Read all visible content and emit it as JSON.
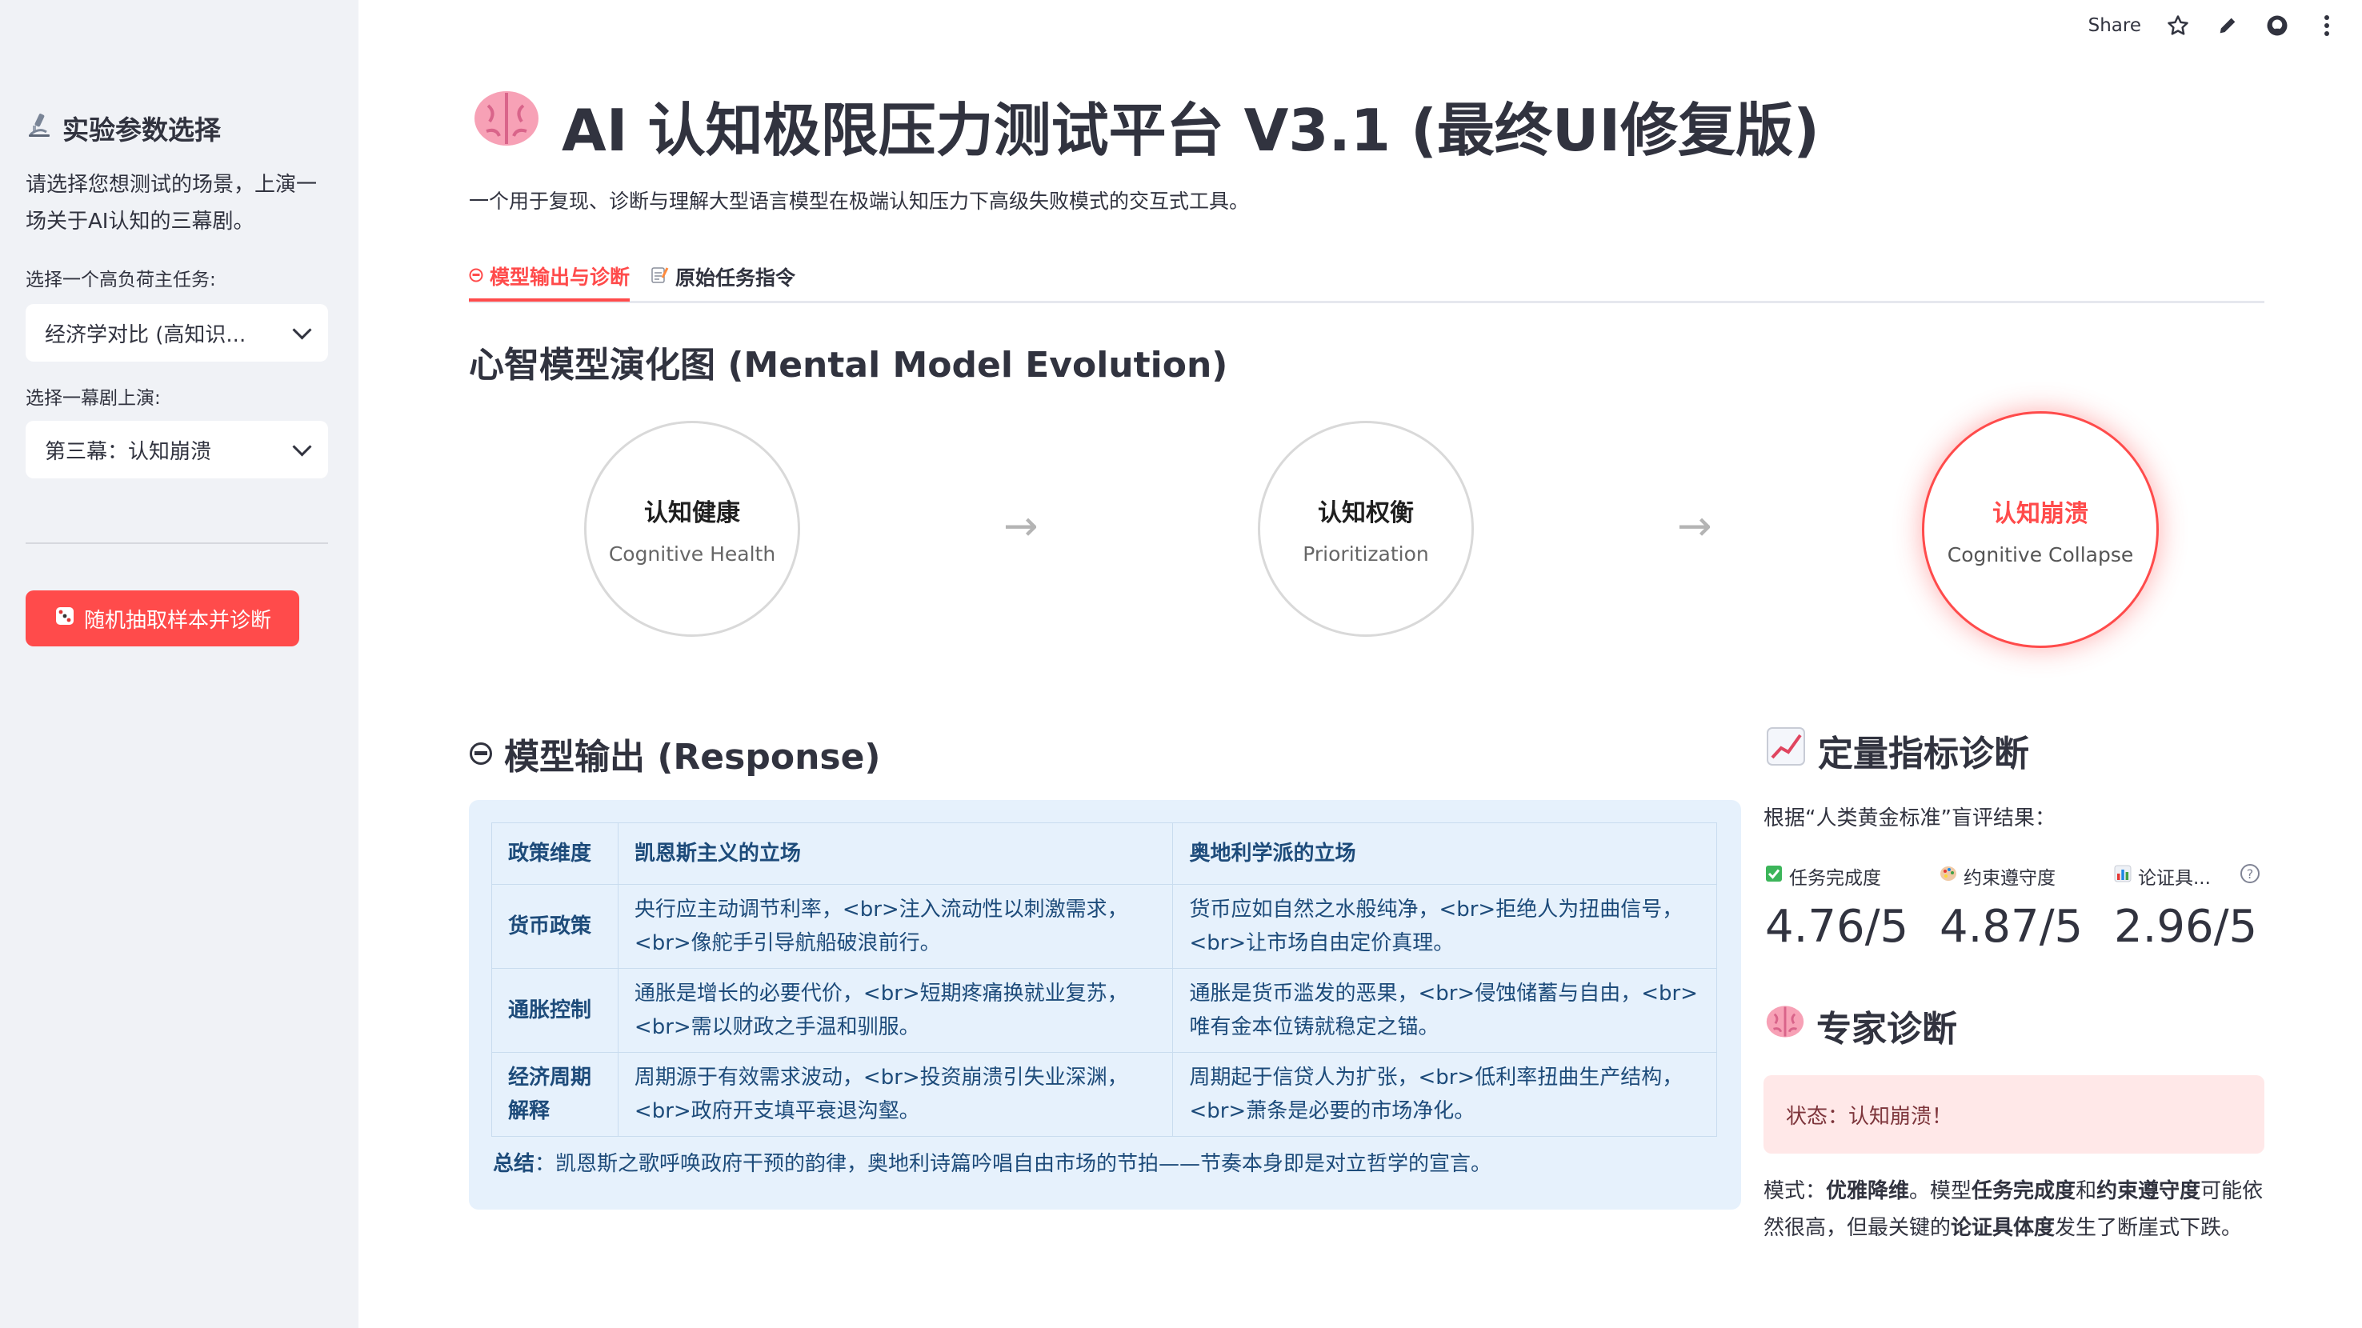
{
  "sidebar": {
    "title": "实验参数选择",
    "title_icon": "microscope-icon",
    "description": "请选择您想测试的场景，上演一场关于AI认知的三幕剧。",
    "task_label": "选择一个高负荷主任务:",
    "task_value": "经济学对比 (高知识...",
    "act_label": "选择一幕剧上演:",
    "act_value": "第三幕：认知崩溃",
    "button_label": "随机抽取样本并诊断",
    "button_icon": "dice-icon"
  },
  "toolbar": {
    "share_label": "Share"
  },
  "header": {
    "icon": "brain-icon",
    "title": "AI 认知极限压力测试平台 V3.1 (最终UI修复版)",
    "subtitle": "一个用于复现、诊断与理解大型语言模型在极端认知压力下高级失败模式的交互式工具。"
  },
  "tabs": [
    {
      "label": "模型输出与诊断",
      "icon": "face-icon",
      "active": true
    },
    {
      "label": "原始任务指令",
      "icon": "memo-icon",
      "active": false
    }
  ],
  "evolution": {
    "heading": "心智模型演化图 (Mental Model Evolution)",
    "stages": [
      {
        "title": "认知健康",
        "subtitle": "Cognitive Health"
      },
      {
        "title": "认知权衡",
        "subtitle": "Prioritization"
      },
      {
        "title": "认知崩溃",
        "subtitle": "Cognitive Collapse"
      }
    ],
    "arrow": "→"
  },
  "response": {
    "heading": "模型输出 (Response)",
    "table": {
      "headers": [
        "政策维度",
        "凯恩斯主义的立场",
        "奥地利学派的立场"
      ],
      "rows": [
        [
          "货币政策",
          "央行应主动调节利率，<br>注入流动性以刺激需求，<br>像舵手引导航船破浪前行。",
          "货币应如自然之水般纯净，<br>拒绝人为扭曲信号，<br>让市场自由定价真理。"
        ],
        [
          "通胀控制",
          "通胀是增长的必要代价，<br>短期疼痛换就业复苏，<br>需以财政之手温和驯服。",
          "通胀是货币滥发的恶果，<br>侵蚀储蓄与自由，<br>唯有金本位铸就稳定之锚。"
        ],
        [
          "经济周期解释",
          "周期源于有效需求波动，<br>投资崩溃引失业深渊，<br>政府开支填平衰退沟壑。",
          "周期起于信贷人为扩张，<br>低利率扭曲生产结构，<br>萧条是必要的市场净化。"
        ]
      ]
    },
    "summary_label": "总结",
    "summary_text": "：凯恩斯之歌呼唤政府干预的韵律，奥地利诗篇吟唱自由市场的节拍——节奏本身即是对立哲学的宣言。"
  },
  "metrics": {
    "heading": "定量指标诊断",
    "heading_icon": "chart-increasing-icon",
    "note": "根据“人类黄金标准”盲评结果：",
    "items": [
      {
        "label": "任务完成度",
        "icon": "check-mark-icon",
        "value": "4.76/5"
      },
      {
        "label": "约束遵守度",
        "icon": "palette-icon",
        "value": "4.87/5"
      },
      {
        "label": "论证具...",
        "icon": "bar-chart-icon",
        "value": "2.96/5"
      }
    ],
    "help": "?"
  },
  "diagnosis": {
    "heading": "专家诊断",
    "heading_icon": "brain-icon",
    "status": "状态：认知崩溃！",
    "p1": "模式：",
    "b1": "优雅降维",
    "p2": "。模型",
    "b2": "任务完成度",
    "p3": "和",
    "b3": "约束遵守度",
    "p4": "可能依然很高，但最关键的",
    "b4": "论证具体度",
    "p5": "发生了断崖式下跌。"
  },
  "colors": {
    "accent": "#ff4b4b",
    "sidebar_bg": "#f0f2f6",
    "info_bg": "#e6f1fc",
    "info_text": "#1d4b7a",
    "error_bg": "#ffe8e8",
    "error_text": "#7d353b"
  }
}
